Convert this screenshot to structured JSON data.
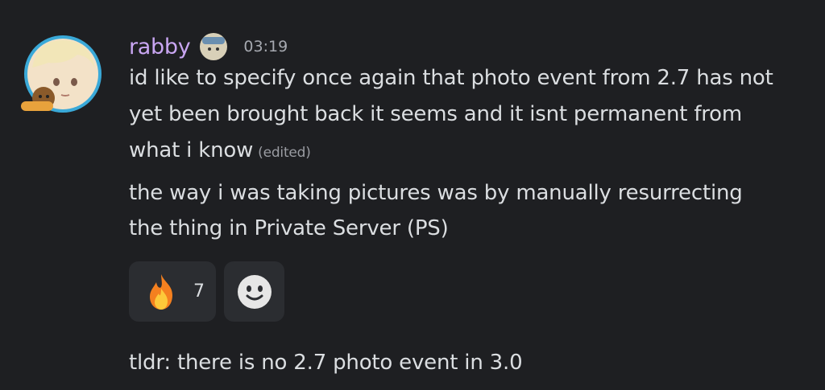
{
  "message": {
    "username": "rabby",
    "timestamp": "03:19",
    "lines": [
      "id like to specify once again that photo event from 2.7 has not",
      "yet been brought back it seems and it isnt permanent from",
      "what i know"
    ],
    "edited_label": "(edited)",
    "second_message_lines": [
      "the way i was taking pictures was by manually resurrecting",
      "the thing in Private Server (PS)"
    ],
    "third_message": "tldr: there is no 2.7 photo event in 3.0"
  },
  "reactions": [
    {
      "emoji": "fire-emoji",
      "count": "7"
    },
    {
      "emoji": "add-reaction-icon"
    }
  ],
  "colors": {
    "background": "#1e1f22",
    "username": "#c9a6f2",
    "text": "#dbdee1",
    "timestamp": "#a6a9b0",
    "reaction_bg": "#2b2d31"
  }
}
